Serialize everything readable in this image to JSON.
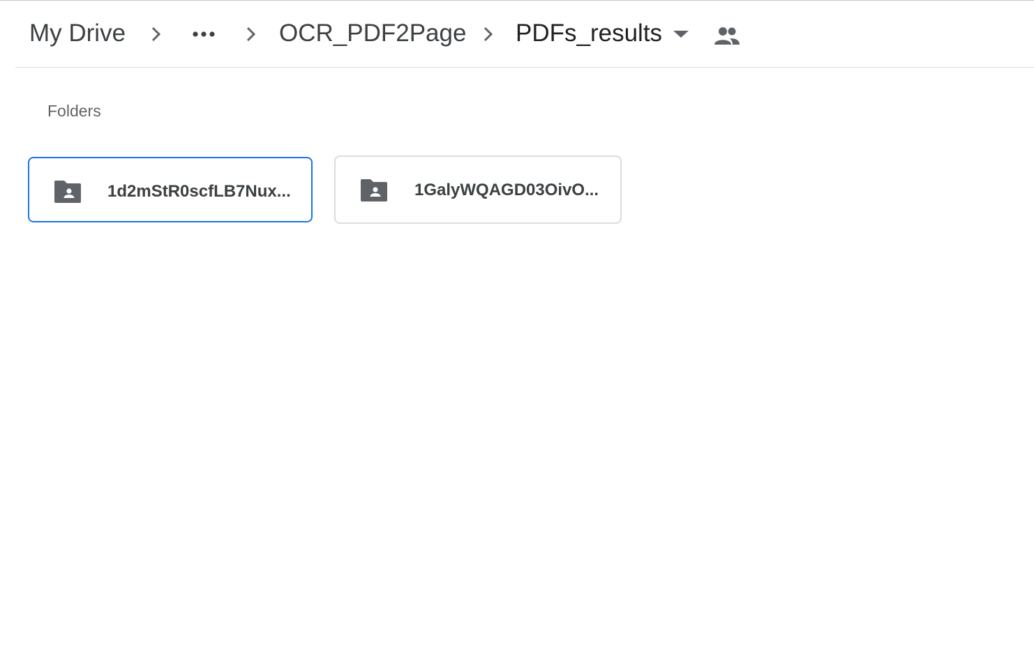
{
  "breadcrumb": {
    "root_label": "My Drive",
    "parent_label": "OCR_PDF2Page",
    "current_label": "PDFs_results",
    "separator_icon": "chevron-right-icon",
    "overflow_icon": "more-horiz-icon",
    "dropdown_icon": "arrow-drop-down-icon",
    "shared_icon": "people-icon"
  },
  "folders_section": {
    "label": "Folders",
    "items": [
      {
        "name": "1d2mStR0scfLB7Nux...",
        "icon": "shared-folder-icon",
        "selected": true
      },
      {
        "name": "1GalyWQAGD03OivO...",
        "icon": "shared-folder-icon",
        "selected": false
      }
    ]
  },
  "colors": {
    "text": "#3c4043",
    "icon": "#5f6368",
    "selection": "#1a73e8",
    "border": "#dadce0"
  }
}
